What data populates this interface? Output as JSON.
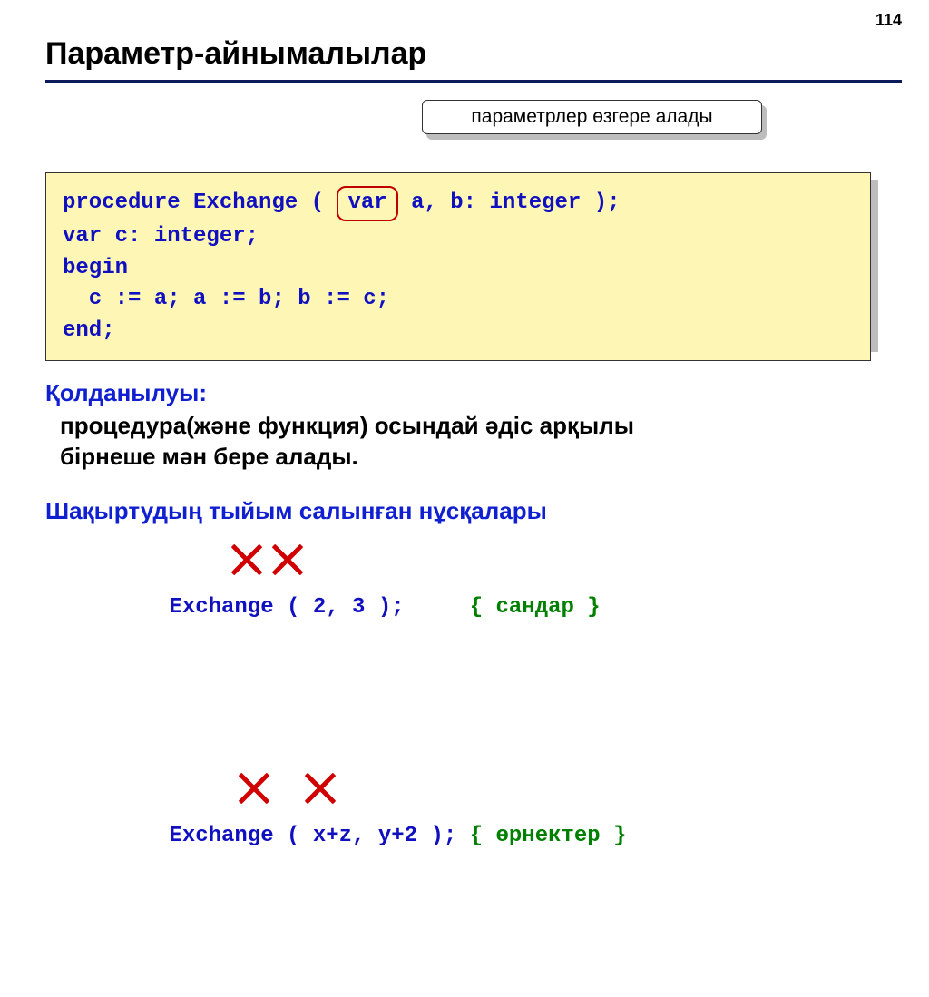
{
  "page_number": "114",
  "title": "Параметр-айнымалылар",
  "callout": "параметрлер өзгере алады",
  "code": {
    "l1_pre": "procedure Exchange ( ",
    "l1_var": "var",
    "l1_post": " a, b: integer );",
    "l2": "var c: integer;",
    "l3": "begin",
    "l4": "  c := a; a := b; b := c;",
    "l5": "end;"
  },
  "usage": {
    "head": "Қолданылуы:",
    "body1": "процедура(және функция) осындай әдіс арқылы",
    "body2": "бірнеше мән бере алады."
  },
  "forbidden": {
    "head": "Шақыртудың тыйым салынған нұсқалары",
    "ex1_code": "Exchange ( 2, 3 );     ",
    "ex1_comment": "{ сандар }",
    "ex2_code": "Exchange ( x+z, y+2 ); ",
    "ex2_comment": "{ өрнектер }"
  }
}
